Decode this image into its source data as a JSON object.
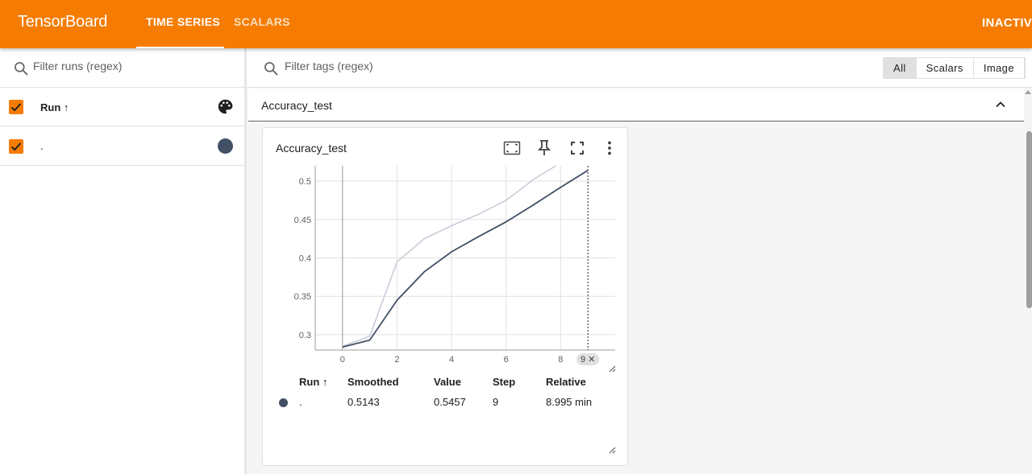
{
  "header": {
    "brand": "TensorBoard",
    "tabs": [
      {
        "label": "TIME SERIES",
        "active": true
      },
      {
        "label": "SCALARS",
        "active": false
      }
    ],
    "status": "INACTIVE"
  },
  "sidebar": {
    "filter_placeholder": "Filter runs (regex)",
    "runs_header": {
      "label": "Run ↑",
      "checked": true,
      "palette_icon": "palette-icon"
    },
    "runs": [
      {
        "name": ".",
        "checked": true,
        "color": "#425066"
      }
    ]
  },
  "main": {
    "filter_placeholder": "Filter tags (regex)",
    "type_filters": [
      {
        "label": "All",
        "selected": true
      },
      {
        "label": "Scalars",
        "selected": false
      },
      {
        "label": "Image",
        "selected": false
      }
    ],
    "group": {
      "title": "Accuracy_test",
      "expanded": true
    },
    "card": {
      "title": "Accuracy_test",
      "actions": [
        "fit-domain-icon",
        "pin-icon",
        "fullscreen-icon",
        "more-vert-icon"
      ],
      "step_marker": "9 ✕",
      "table": {
        "headers": [
          "Run ↑",
          "Smoothed",
          "Value",
          "Step",
          "Relative"
        ],
        "rows": [
          {
            "run": ".",
            "smoothed": "0.5143",
            "value": "0.5457",
            "step": "9",
            "relative": "8.995 min",
            "color": "#425066"
          }
        ]
      }
    }
  },
  "colors": {
    "brand": "#f57c00",
    "run": "#425066",
    "raw_line": "#c8ced9"
  },
  "chart_data": {
    "type": "line",
    "title": "Accuracy_test",
    "xlabel": "",
    "ylabel": "",
    "xlim": [
      -1,
      10
    ],
    "ylim": [
      0.28,
      0.52
    ],
    "x_ticks": [
      "0",
      "2",
      "4",
      "6",
      "8"
    ],
    "y_ticks": [
      "0.3",
      "0.35",
      "0.4",
      "0.45",
      "0.5"
    ],
    "grid": true,
    "series": [
      {
        "role": "smoothed",
        "color": "#425066",
        "x": [
          0,
          1,
          2,
          3,
          4,
          5,
          6,
          7,
          8,
          9
        ],
        "y": [
          0.284,
          0.293,
          0.345,
          0.382,
          0.408,
          0.428,
          0.447,
          0.469,
          0.492,
          0.514
        ]
      },
      {
        "role": "raw",
        "color": "#c8ced9",
        "x": [
          0,
          1,
          2,
          3,
          4,
          5,
          6,
          7,
          8,
          9
        ],
        "y": [
          0.285,
          0.298,
          0.395,
          0.425,
          0.442,
          0.457,
          0.475,
          0.502,
          0.524,
          0.546
        ]
      }
    ],
    "step_cursor": 9
  }
}
